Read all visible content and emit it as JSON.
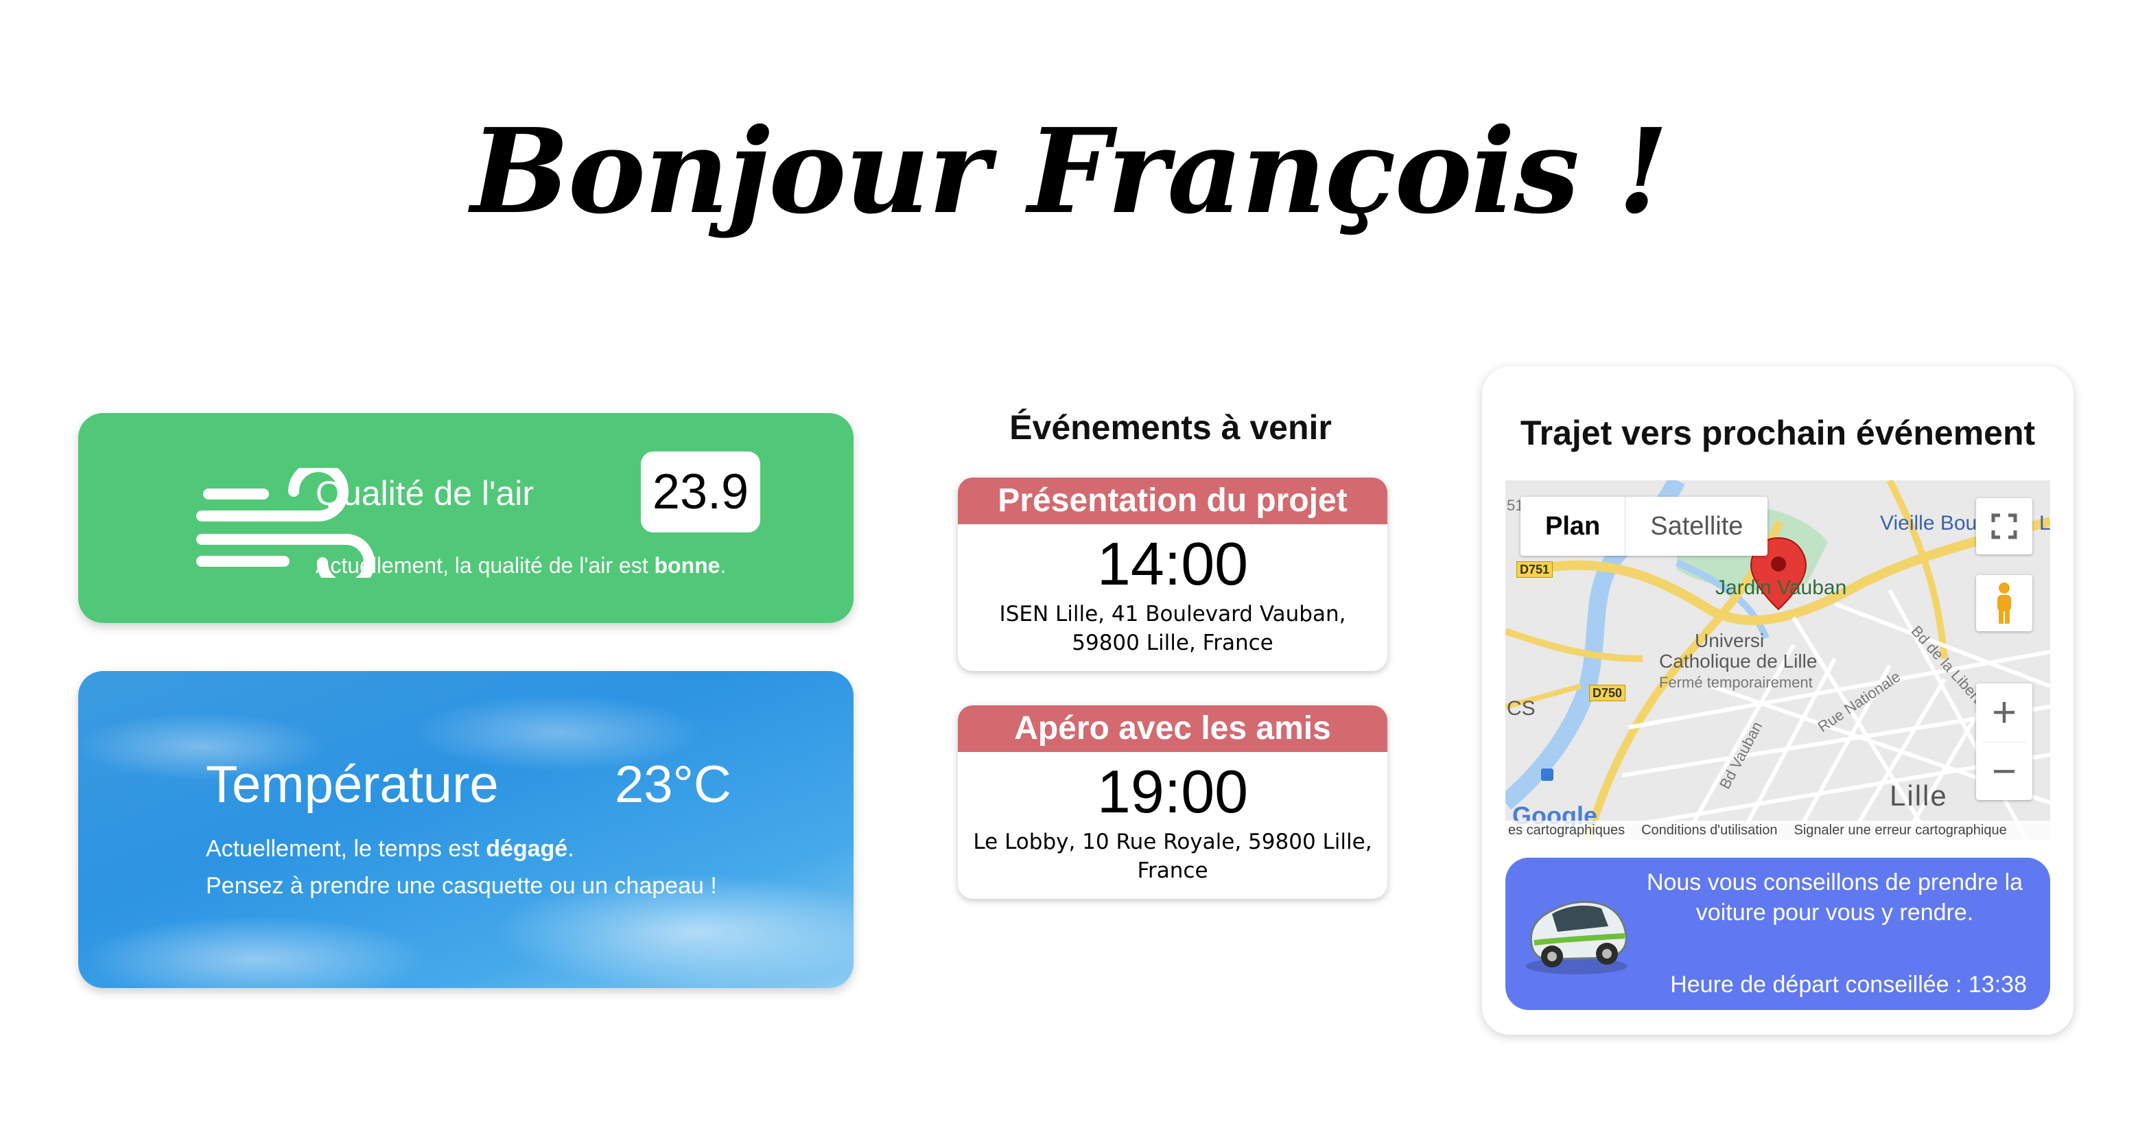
{
  "greeting": "Bonjour François !",
  "air_quality": {
    "title": "Qualité de l'air",
    "value": "23.9",
    "desc_prefix": "Actuellement, la qualité de l'air est ",
    "desc_quality": "bonne",
    "desc_suffix": ".",
    "icon": "wind-icon",
    "color": "#51c878"
  },
  "temperature": {
    "title": "Température",
    "value": "23°C",
    "line1_prefix": "Actuellement, le temps est ",
    "line1_weather": "dégagé",
    "line1_suffix": ".",
    "line2": "Pensez à prendre une casquette ou un chapeau !"
  },
  "events": {
    "title": "Événements à venir",
    "header_color": "#d36a70",
    "items": [
      {
        "name": "Présentation du projet",
        "time": "14:00",
        "address": "ISEN Lille, 41 Boulevard Vauban, 59800 Lille, France"
      },
      {
        "name": "Apéro avec les amis",
        "time": "19:00",
        "address": "Le Lobby, 10 Rue Royale, 59800 Lille, France"
      }
    ]
  },
  "route": {
    "title": "Trajet vers prochain événement",
    "map": {
      "tab_plan": "Plan",
      "tab_satellite": "Satellite",
      "labels": {
        "jardin": "Jardin Vauban",
        "universite_1": "Universi",
        "universite_2": "Catholique de Lille",
        "ferme": "Fermé temporairement",
        "vieille": "Vieille Bou",
        "lille": "Lille",
        "bd_vauban": "Bd Vauban",
        "rue_nationale": "Rue Nationale",
        "bd_liberte": "Bd de la Liberté",
        "d751": "D751",
        "d750": "D750",
        "google": "Google",
        "left_edge": "51",
        "cs": "CS",
        "l_edge": "L"
      },
      "footer": {
        "data": "es cartographiques",
        "terms": "Conditions d'utilisation",
        "report": "Signaler une erreur cartographique"
      },
      "zoom_in": "+",
      "zoom_out": "−"
    },
    "advice": {
      "text": "Nous vous conseillons de prendre la voiture pour vous y rendre.",
      "departure": "Heure de départ conseillée : 13:38",
      "color": "#6079f0"
    }
  }
}
